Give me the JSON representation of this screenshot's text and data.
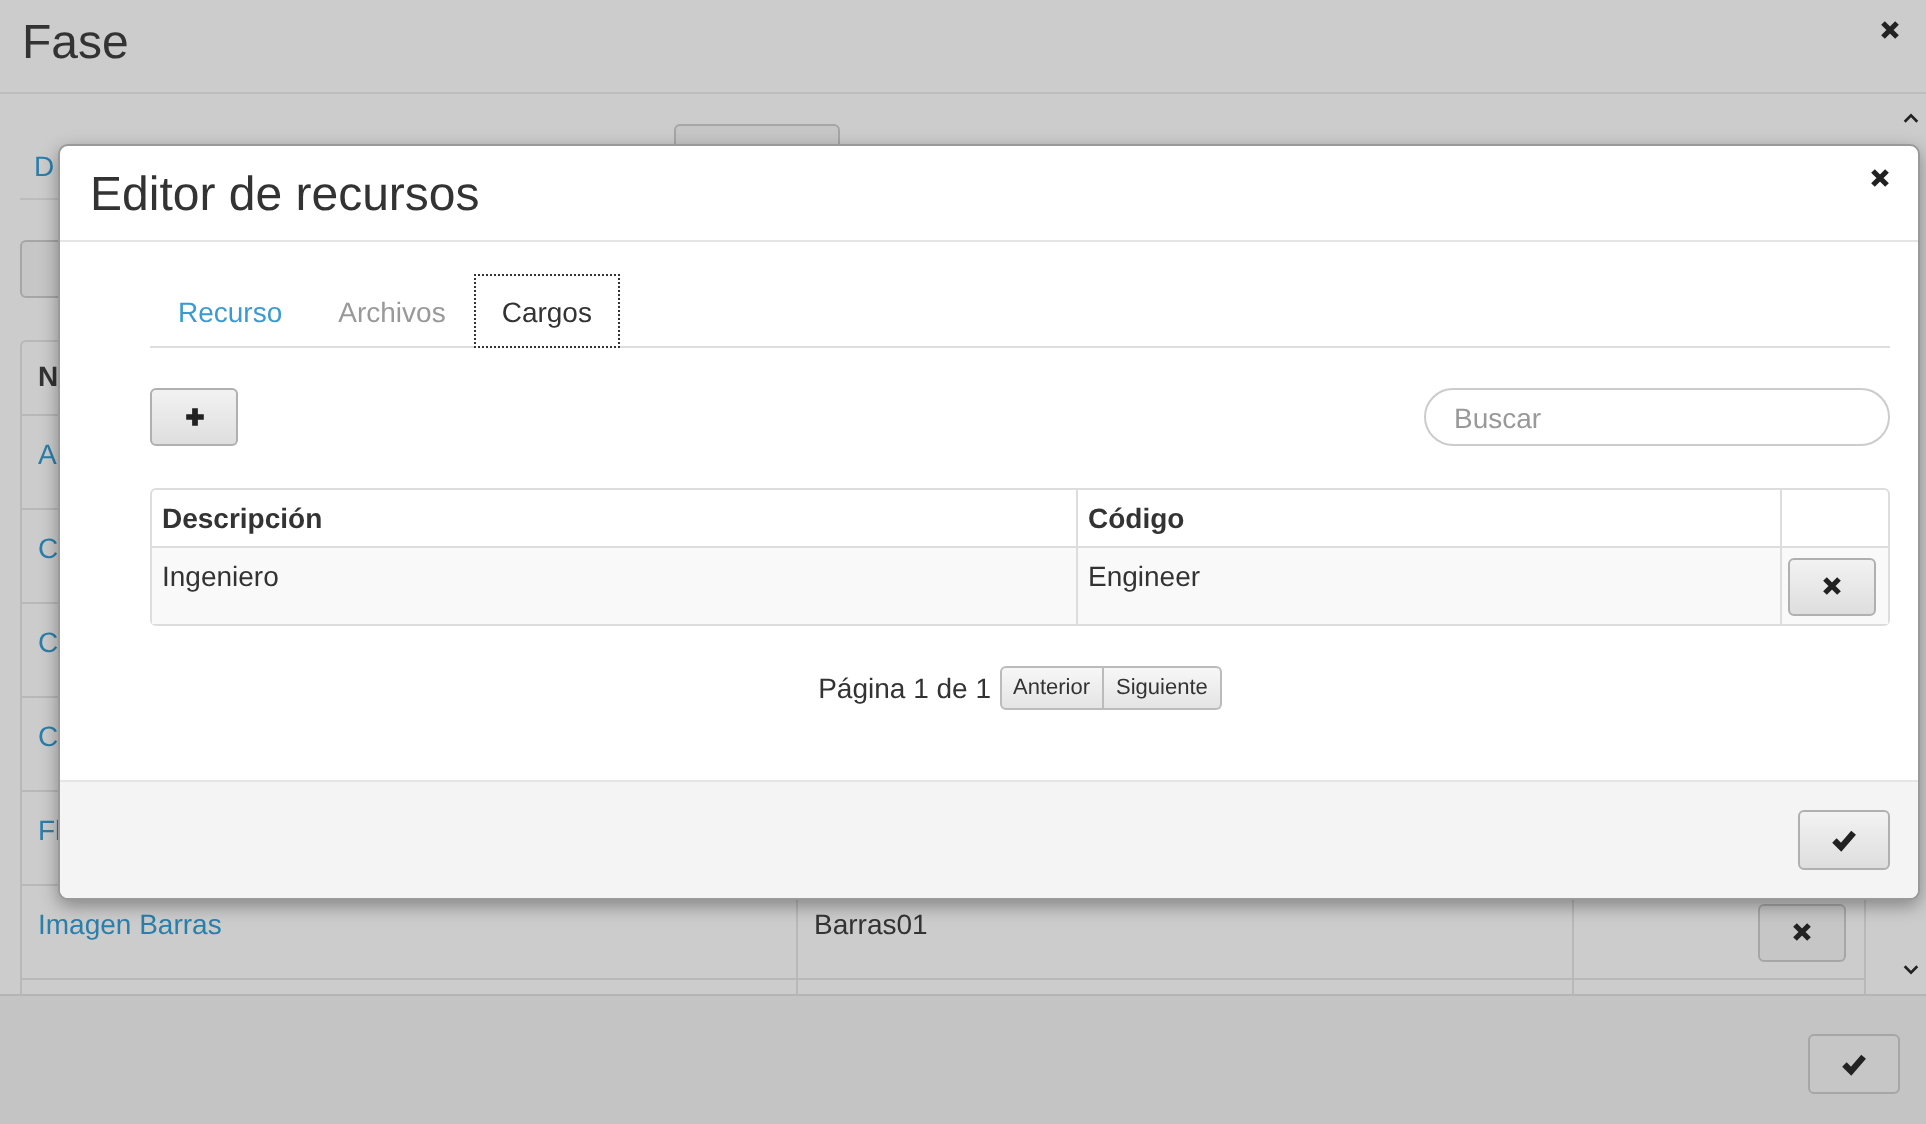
{
  "background_dialog": {
    "title": "Fase",
    "tab_label": "D",
    "table": {
      "columns": [
        "N"
      ],
      "rows": [
        {
          "name": "A"
        },
        {
          "name": "C"
        },
        {
          "name": "C"
        },
        {
          "name": "C"
        },
        {
          "name": "Fl"
        },
        {
          "name": "Imagen Barras",
          "code": "Barras01",
          "deletable": true
        }
      ]
    }
  },
  "editor": {
    "title": "Editor de recursos",
    "tabs": [
      {
        "label": "Recurso",
        "selected": false,
        "disabled": false
      },
      {
        "label": "Archivos",
        "selected": false,
        "disabled": true
      },
      {
        "label": "Cargos",
        "selected": true,
        "disabled": false
      }
    ],
    "search": {
      "placeholder": "Buscar"
    },
    "table": {
      "columns": [
        "Descripción",
        "Código"
      ],
      "rows": [
        {
          "description": "Ingeniero",
          "code": "Engineer"
        }
      ]
    },
    "pagination": {
      "text": "Página 1 de 1",
      "buttons": [
        "Anterior",
        "Siguiente"
      ]
    }
  }
}
